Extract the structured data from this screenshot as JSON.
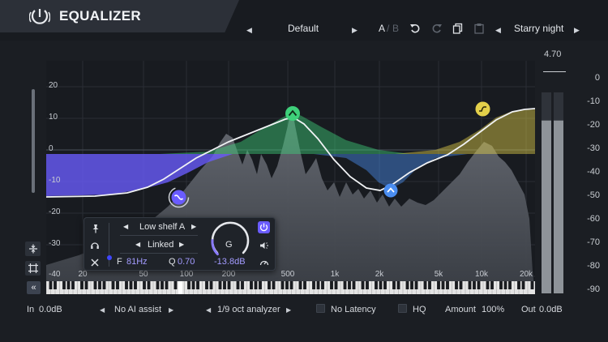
{
  "header": {
    "title": "EQUALIZER",
    "preset_name": "Default",
    "compare_a": "A",
    "compare_slash": "/",
    "compare_b": "B",
    "preset_nav_name": "Starry night"
  },
  "plot": {
    "y_labels": [
      "20",
      "10",
      "0",
      "-10",
      "-20",
      "-30",
      "-40"
    ],
    "x_labels": [
      "20",
      "50",
      "100",
      "200",
      "500",
      "1k",
      "2k",
      "5k",
      "10k",
      "20k"
    ],
    "nodes": [
      {
        "name": "low-shelf-node",
        "freq_hz": 81,
        "gain_db": -13.8,
        "color": "#6a5cff"
      },
      {
        "name": "bell-node-500",
        "freq_hz": 500,
        "gain_db": 12,
        "color": "#3ed07a"
      },
      {
        "name": "bell-node-2k",
        "freq_hz": 2100,
        "gain_db": -11,
        "color": "#4a8df0"
      },
      {
        "name": "high-shelf-node",
        "freq_hz": 15000,
        "gain_db": 15,
        "color": "#e3d04a"
      }
    ]
  },
  "band_popup": {
    "type_label": "Low shelf A",
    "link_label": "Linked",
    "freq_label": "F",
    "freq_value": "81Hz",
    "q_label": "Q",
    "q_value": "0.70",
    "gain_knob_label": "G",
    "gain_value": "-13.8dB",
    "gain_fraction": 0.18
  },
  "meter": {
    "peak_value": "4.70",
    "labels": [
      "0",
      "-10",
      "-20",
      "-30",
      "-40",
      "-50",
      "-60",
      "-70",
      "-80",
      "-90"
    ],
    "level_fraction": 0.86
  },
  "footer": {
    "in_label": "In",
    "in_value": "0.0dB",
    "ai_assist": "No AI assist",
    "analyzer": "1/9 oct analyzer",
    "latency": "No Latency",
    "hq": "HQ",
    "amount_label": "Amount",
    "amount_value": "100%",
    "out_label": "Out",
    "out_value": "0.0dB"
  },
  "colors": {
    "accent": "#6a5cff",
    "green_band": "#3ed07a",
    "blue_band": "#4a8df0",
    "yellow_band": "#e3d04a"
  }
}
